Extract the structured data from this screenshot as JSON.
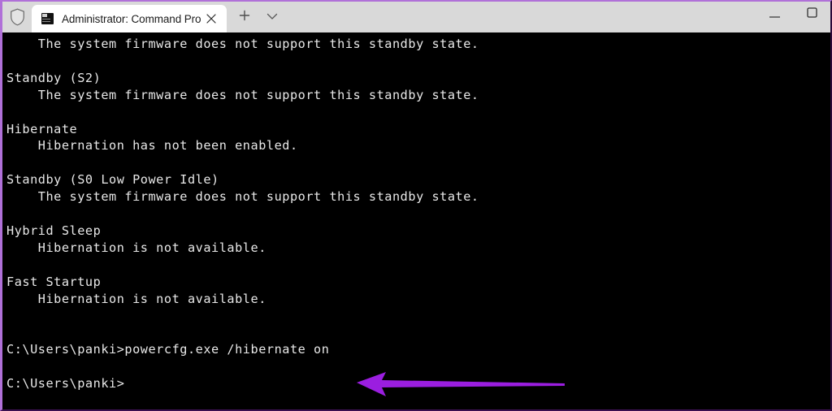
{
  "window": {
    "title": "Administrator: Command Prompt",
    "accent_border_color": "#b070d8",
    "titlebar_bg": "#d9d9d9",
    "terminal_bg": "#000000",
    "terminal_fg": "#e8e8e8"
  },
  "titlebar": {
    "shield_icon": "shield-icon",
    "tab": {
      "icon": "console-icon",
      "label": "Administrator: Command Pro",
      "close_label": "×",
      "close_icon": "close-icon"
    },
    "new_tab": {
      "label": "+",
      "icon": "plus-icon"
    },
    "dropdown": {
      "label": "⌄",
      "icon": "chevron-down-icon"
    },
    "controls": {
      "minimize": {
        "label": "—",
        "icon": "minimize-icon"
      },
      "maximize": {
        "label": "☐",
        "icon": "maximize-icon"
      }
    }
  },
  "terminal": {
    "lines": [
      "    The system firmware does not support this standby state.",
      "",
      "Standby (S2)",
      "    The system firmware does not support this standby state.",
      "",
      "Hibernate",
      "    Hibernation has not been enabled.",
      "",
      "Standby (S0 Low Power Idle)",
      "    The system firmware does not support this standby state.",
      "",
      "Hybrid Sleep",
      "    Hibernation is not available.",
      "",
      "Fast Startup",
      "    Hibernation is not available.",
      "",
      "",
      "C:\\Users\\panki>powercfg.exe /hibernate on",
      "",
      "C:\\Users\\panki>"
    ],
    "prompt": "C:\\Users\\panki>",
    "command": "powercfg.exe /hibernate on",
    "user": "panki"
  },
  "annotation": {
    "type": "arrow",
    "direction": "left",
    "color": "#9b1ee0",
    "points_to": "powercfg.exe /hibernate on"
  }
}
